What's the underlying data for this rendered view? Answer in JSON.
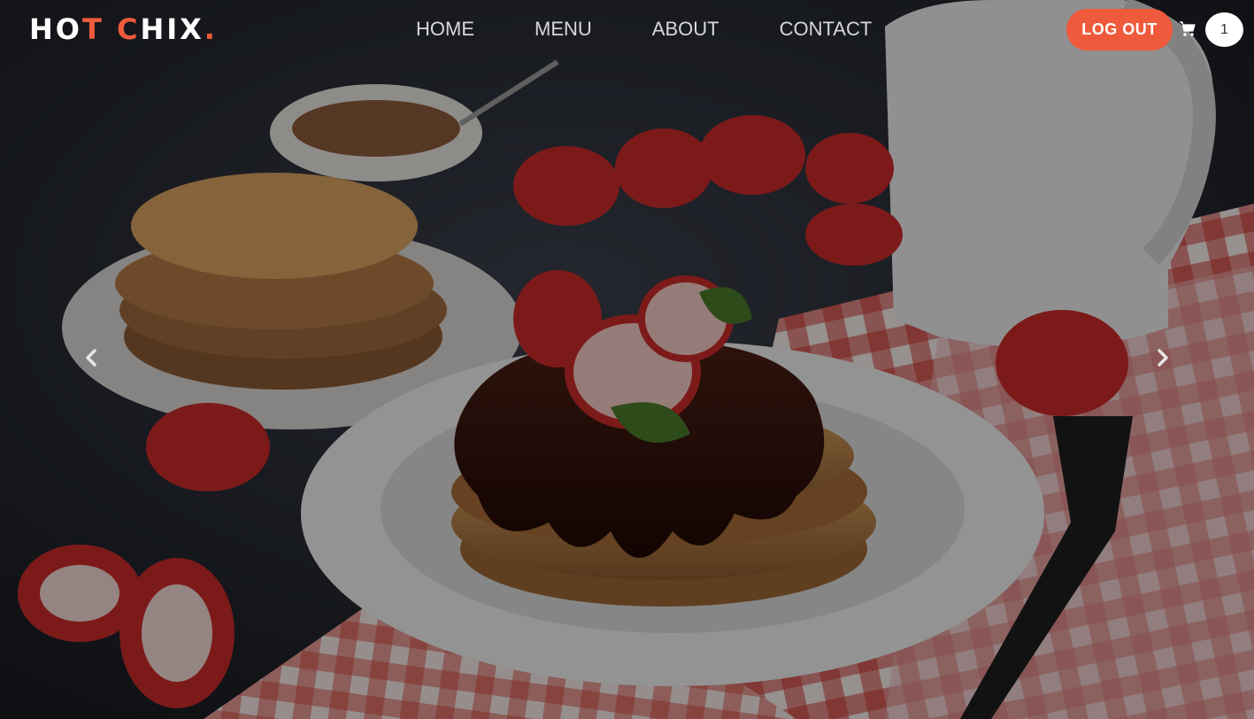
{
  "brand": {
    "part1": "HO",
    "part2": "T",
    "part3": " C",
    "part4": "HIX",
    "part5": "."
  },
  "nav": {
    "items": [
      {
        "label": "HOME"
      },
      {
        "label": "MENU"
      },
      {
        "label": "ABOUT"
      },
      {
        "label": "CONTACT"
      }
    ]
  },
  "auth": {
    "logout_label": "LOG OUT"
  },
  "cart": {
    "icon": "cart-icon",
    "count": "1"
  },
  "carousel": {
    "prev_icon": "chevron-left-icon",
    "next_icon": "chevron-right-icon"
  },
  "colors": {
    "accent": "#ef5a3c",
    "nav_text": "#d8d8d8",
    "overlay": "rgba(0,0,0,0.38)"
  }
}
